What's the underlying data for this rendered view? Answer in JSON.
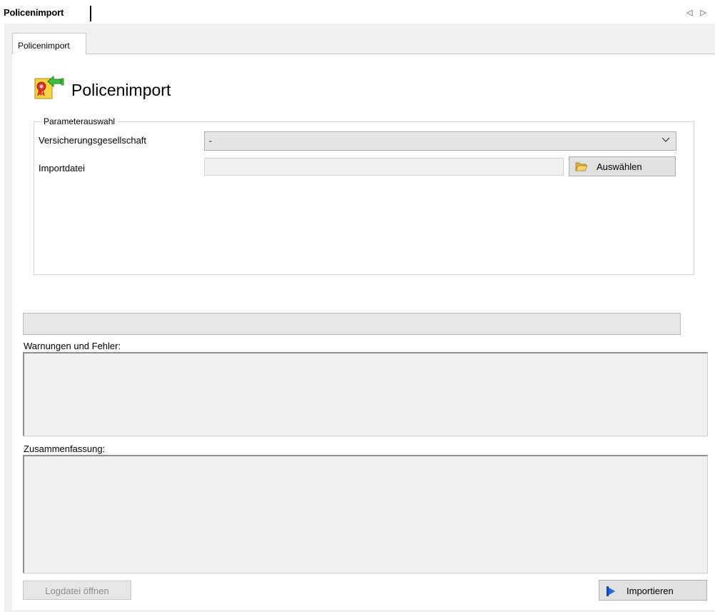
{
  "document_tab": {
    "label": "Policenimport",
    "nav": "◁ ▷"
  },
  "inner_tab": {
    "label": "Policenimport"
  },
  "header": {
    "title": "Policenimport",
    "icon": "policy-import-icon"
  },
  "parameters": {
    "legend": "Parameterauswahl",
    "insurer_label": "Versicherungsgesellschaft",
    "insurer_value": "-",
    "file_label": "Importdatei",
    "file_value": "",
    "select_button": "Auswählen"
  },
  "warnings_label": "Warnungen und Fehler:",
  "summary_label": "Zusammenfassung:",
  "footer": {
    "log_button": "Logdatei öffnen",
    "import_button": "Importieren"
  },
  "colors": {
    "panel_bg": "#f0f0f0",
    "button_bg": "#e1e1e1",
    "accent_blue": "#1e6fd9"
  }
}
